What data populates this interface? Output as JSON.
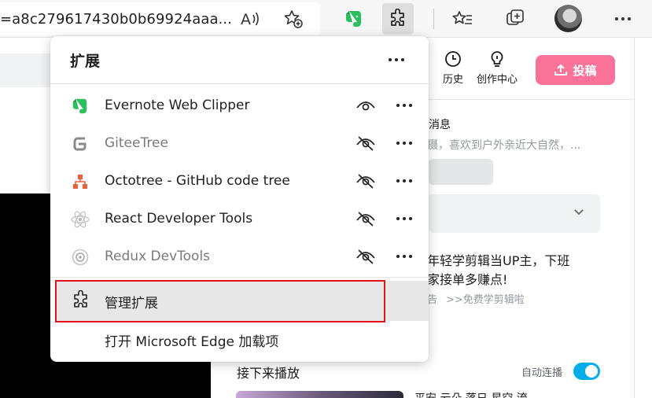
{
  "browser": {
    "url_visible": "=a8c279617430b0b69924aaa...",
    "read_aloud_label": "A",
    "colors": {
      "toolbar_bg": "#f7f7f7",
      "active_button": "#dedede"
    },
    "icons": [
      "read-aloud-icon",
      "add-favorite-icon",
      "evernote-icon",
      "extensions-icon",
      "favorites-icon",
      "collections-icon",
      "profile-avatar",
      "more-menu-icon"
    ]
  },
  "page": {
    "header": {
      "history_label": "历史",
      "creator_label": "创作中心",
      "upload_label": "投稿"
    },
    "messages_label": "消息",
    "desc_text": "摄，喜欢到户外亲近大自然，...",
    "ad_line1": "年轻学剪辑当UP主，下班",
    "ad_line2": "家接单多赚点!",
    "ad_tag": "告",
    "ad_link": ">>免费学剪辑啦",
    "next_label": "接下来播放",
    "autoplay_label": "自动连播",
    "autoplay_on": true,
    "next_video_title": "平安 云朵 落日 星空 流",
    "colors": {
      "brand_pink": "#fb7299",
      "toggle_blue": "#00aeec"
    }
  },
  "extensions_panel": {
    "title": "扩展",
    "more_label": "...",
    "items": [
      {
        "name": "Evernote Web Clipper",
        "visible": true,
        "icon": "evernote-icon",
        "enabled": true
      },
      {
        "name": "GiteeTree",
        "visible": false,
        "icon": "gitee-icon",
        "enabled": false
      },
      {
        "name": "Octotree - GitHub code tree",
        "visible": false,
        "icon": "octotree-icon",
        "enabled": true
      },
      {
        "name": "React Developer Tools",
        "visible": false,
        "icon": "react-icon",
        "enabled": true
      },
      {
        "name": "Redux DevTools",
        "visible": false,
        "icon": "redux-icon",
        "enabled": false
      }
    ],
    "manage_label": "管理扩展",
    "addons_label": "打开 Microsoft Edge 加载项"
  }
}
